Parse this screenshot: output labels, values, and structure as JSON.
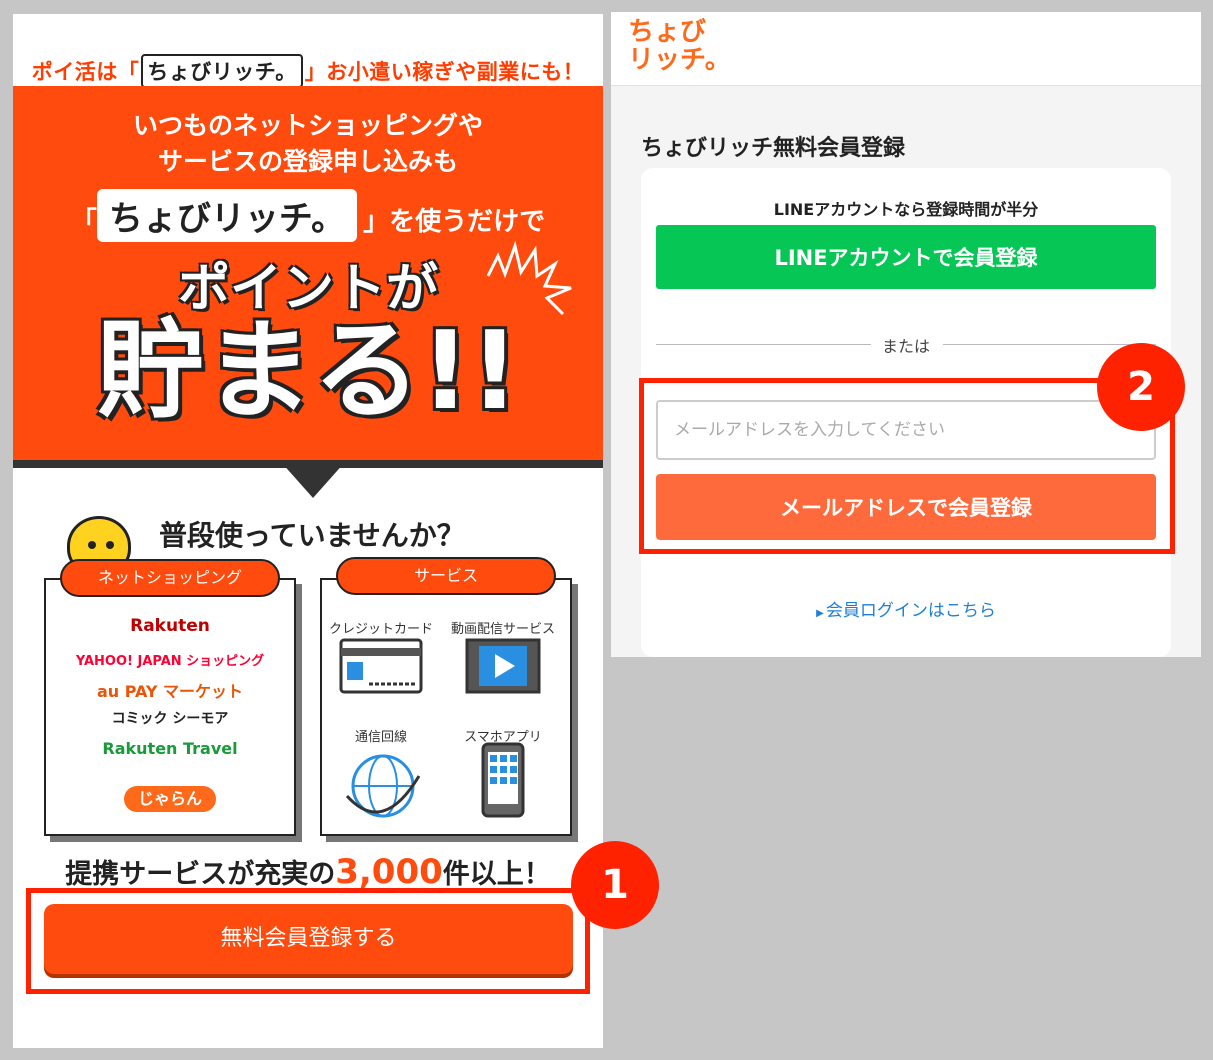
{
  "left": {
    "tagline": {
      "pre": "ポイ活は「",
      "logo": "ちょびリッチ。",
      "post": "」お小遣い稼ぎや副業にも！"
    },
    "hero": {
      "line1": "いつものネットショッピングや",
      "line2": "サービスの登録申し込みも",
      "line3_logo": "ちょびリッチ。",
      "line3_text": "を使うだけで",
      "line4": "ポイントが",
      "line5": "貯まる!!"
    },
    "question": "普段使っていませんか？",
    "shopping": {
      "label": "ネットショッピング",
      "brands": [
        "Rakuten",
        "YAHOO! JAPAN ショッピング",
        "au PAY マーケット",
        "コミック シーモア",
        "Rakuten Travel",
        "じゃらん"
      ]
    },
    "services": {
      "label": "サービス",
      "items": [
        "クレジットカード",
        "動画配信サービス",
        "通信回線",
        "スマホアプリ"
      ]
    },
    "partners": {
      "pre": "提携サービスが充実の",
      "num": "3,000",
      "post": "件以上！"
    },
    "cta_label": "無料会員登録する",
    "badge": "1"
  },
  "right": {
    "logo_line1": "ちょび",
    "logo_line2": "リッチ。",
    "title": "ちょびリッチ無料会員登録",
    "line_hint": "LINEアカウントなら登録時間が半分",
    "line_button": "LINEアカウントで会員登録",
    "or_text": "または",
    "email_placeholder": "メールアドレスを入力してください",
    "email_button": "メールアドレスで会員登録",
    "login_link": "会員ログインはこちら",
    "badge": "2"
  },
  "colors": {
    "brand_orange": "#ff4b0e",
    "line_green": "#06c755",
    "highlight_red": "#ff2200",
    "link_blue": "#1e7fd6"
  }
}
